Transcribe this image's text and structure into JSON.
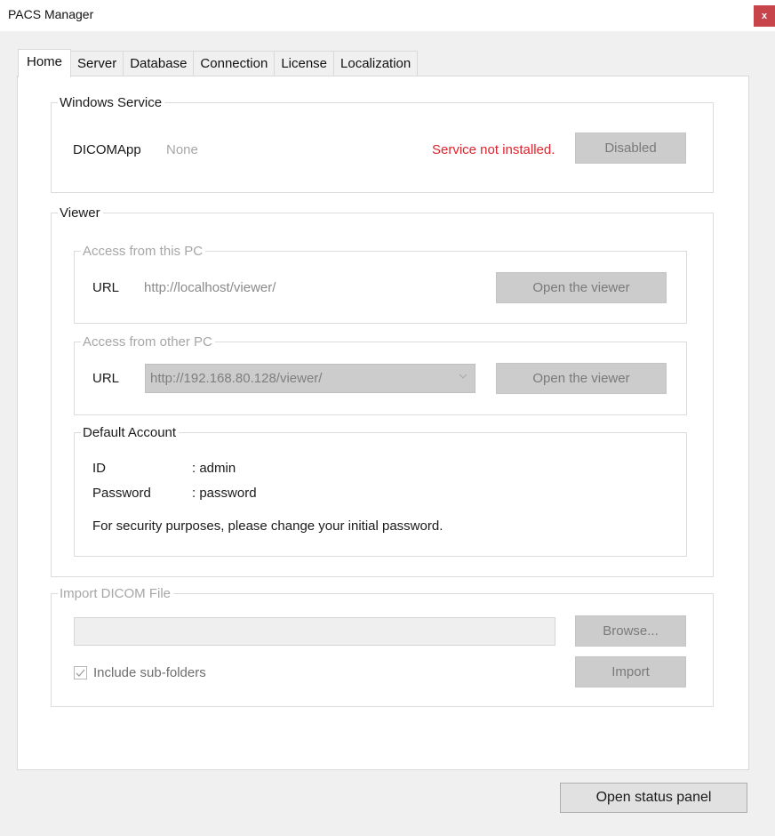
{
  "window": {
    "title": "PACS Manager",
    "close_glyph": "x"
  },
  "tabs": [
    {
      "label": "Home",
      "active": true
    },
    {
      "label": "Server",
      "active": false
    },
    {
      "label": "Database",
      "active": false
    },
    {
      "label": "Connection",
      "active": false
    },
    {
      "label": "License",
      "active": false
    },
    {
      "label": "Localization",
      "active": false
    }
  ],
  "windows_service": {
    "legend": "Windows Service",
    "service_name": "DICOMApp",
    "service_value": "None",
    "status": "Service not installed.",
    "status_color": "#e0232d",
    "button_label": "Disabled"
  },
  "viewer": {
    "legend": "Viewer",
    "local": {
      "legend": "Access from this PC",
      "url_label": "URL",
      "url_value": "http://localhost/viewer/",
      "button_label": "Open the viewer"
    },
    "other": {
      "legend": "Access from other PC",
      "url_label": "URL",
      "url_selected": "http://192.168.80.128/viewer/",
      "button_label": "Open the viewer"
    },
    "default_account": {
      "legend": "Default Account",
      "id_label": "ID",
      "id_value": ": admin",
      "password_label": "Password",
      "password_value": ": password",
      "note": "For security purposes, please change your initial password."
    }
  },
  "import": {
    "legend": "Import DICOM File",
    "path_value": "",
    "browse_label": "Browse...",
    "include_subfolders_label": "Include sub-folders",
    "include_subfolders_checked": true,
    "import_label": "Import"
  },
  "footer": {
    "status_button_label": "Open status panel"
  }
}
